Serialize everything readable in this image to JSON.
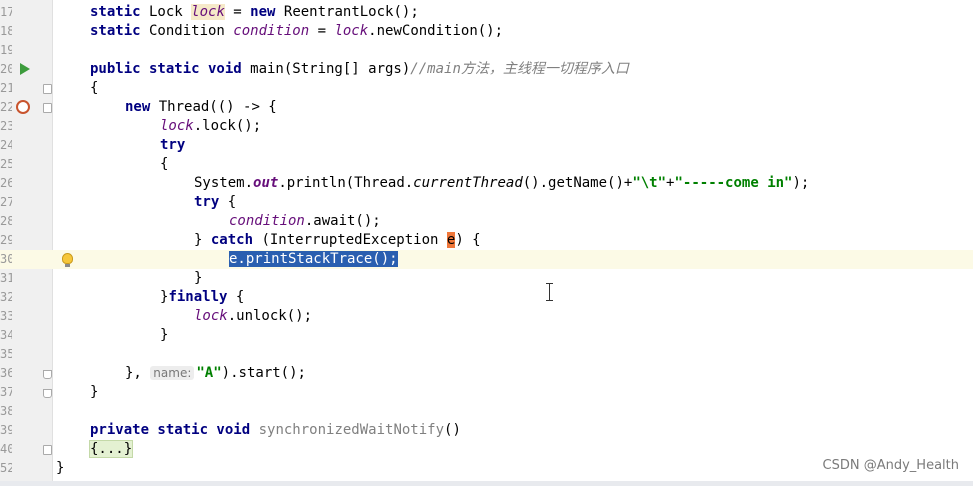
{
  "lines": [
    {
      "n": "17",
      "h": "static Lock lock = new ReentrantLock();"
    },
    {
      "n": "18",
      "h": "static Condition condition = lock.newCondition();"
    },
    {
      "n": "19",
      "h": ""
    },
    {
      "n": "20",
      "h": "public static void main(String[] args)//main方法，主线程一切程序入口"
    },
    {
      "n": "21",
      "h": "{"
    },
    {
      "n": "22",
      "h": "new Thread(() -> {"
    },
    {
      "n": "23",
      "h": "lock.lock();"
    },
    {
      "n": "24",
      "h": "try"
    },
    {
      "n": "25",
      "h": "{"
    },
    {
      "n": "26",
      "h": "System.out.println(Thread.currentThread().getName()+\"\\t\"+\"-----come in\");"
    },
    {
      "n": "27",
      "h": "try {"
    },
    {
      "n": "28",
      "h": "condition.await();"
    },
    {
      "n": "29",
      "h": "} catch (InterruptedException e) {"
    },
    {
      "n": "30",
      "h": "e.printStackTrace();"
    },
    {
      "n": "31",
      "h": "}"
    },
    {
      "n": "32",
      "h": "}finally {"
    },
    {
      "n": "33",
      "h": "lock.unlock();"
    },
    {
      "n": "34",
      "h": "}"
    },
    {
      "n": "35",
      "h": ""
    },
    {
      "n": "36",
      "h": "}, name: \"A\").start();"
    },
    {
      "n": "37",
      "h": "}"
    },
    {
      "n": "38",
      "h": ""
    },
    {
      "n": "39",
      "h": "private static void synchronizedWaitNotify()"
    },
    {
      "n": "40",
      "h": "{...}"
    },
    {
      "n": "52",
      "h": "}"
    }
  ],
  "watermark": "CSDN @Andy_Health",
  "colors": {
    "keyword": "#000080",
    "field": "#660e7a",
    "comment": "#808080",
    "string": "#008000",
    "selection": "#2a5fb0",
    "current_line": "#fcfae6",
    "run_icon": "#3d9c3d"
  }
}
